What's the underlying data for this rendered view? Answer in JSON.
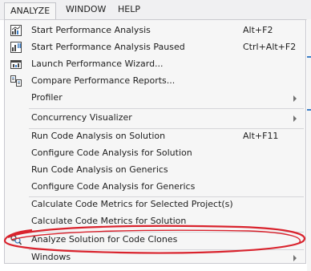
{
  "menubar": {
    "items": [
      {
        "label": "ANALYZE"
      },
      {
        "label": "WINDOW"
      },
      {
        "label": "HELP"
      }
    ]
  },
  "menu": {
    "items": [
      {
        "label": "Start Performance Analysis",
        "shortcut": "Alt+F2",
        "icon": "performance-icon"
      },
      {
        "label": "Start Performance Analysis Paused",
        "shortcut": "Ctrl+Alt+F2",
        "icon": "performance-paused-icon"
      },
      {
        "label": "Launch Performance Wizard...",
        "shortcut": "",
        "icon": "wizard-icon"
      },
      {
        "label": "Compare Performance Reports...",
        "shortcut": "",
        "icon": "compare-reports-icon"
      },
      {
        "label": "Profiler",
        "shortcut": "",
        "submenu": true
      },
      {
        "label": "Concurrency Visualizer",
        "shortcut": "",
        "submenu": true
      },
      {
        "label": "Run Code Analysis on Solution",
        "shortcut": "Alt+F11"
      },
      {
        "label": "Configure Code Analysis for Solution",
        "shortcut": ""
      },
      {
        "label": "Run Code Analysis on Generics",
        "shortcut": ""
      },
      {
        "label": "Configure Code Analysis for Generics",
        "shortcut": ""
      },
      {
        "label": "Calculate Code Metrics for Selected Project(s)",
        "shortcut": ""
      },
      {
        "label": "Calculate Code Metrics for Solution",
        "shortcut": ""
      },
      {
        "label": "Analyze Solution for Code Clones",
        "shortcut": "",
        "icon": "code-clones-icon"
      },
      {
        "label": "Windows",
        "shortcut": "",
        "submenu": true
      }
    ]
  },
  "colors": {
    "accent": "#3e7fc6",
    "annotation": "#d9232d"
  }
}
